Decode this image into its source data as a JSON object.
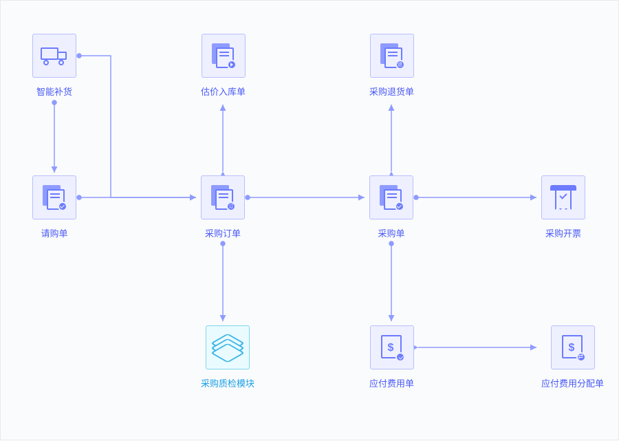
{
  "nodes": {
    "smart_replenish": {
      "label": "智能补货",
      "badge": ""
    },
    "purchase_request": {
      "label": "请购单",
      "badge_type": "check"
    },
    "valuation_inbound": {
      "label": "估价入库单",
      "badge_type": "arrow"
    },
    "purchase_order": {
      "label": "采购订单",
      "badge_text": "订"
    },
    "purchase_return": {
      "label": "采购退货单",
      "badge_text": "退"
    },
    "purchase_receipt": {
      "label": "采购单",
      "badge_type": "check"
    },
    "purchase_invoice": {
      "label": "采购开票"
    },
    "purchase_qc": {
      "label": "采购质检模块"
    },
    "payable_expense": {
      "label": "应付费用单",
      "badge_type": "check"
    },
    "payable_alloc": {
      "label": "应付费用分配单",
      "badge_type": "swap"
    }
  },
  "chart_data": {
    "type": "flow-diagram",
    "nodes": [
      {
        "id": "smart_replenish",
        "label": "智能补货",
        "row": 0,
        "col": 0,
        "icon": "truck"
      },
      {
        "id": "valuation_inbound",
        "label": "估价入库单",
        "row": 0,
        "col": 1,
        "icon": "document-arrow"
      },
      {
        "id": "purchase_return",
        "label": "采购退货单",
        "row": 0,
        "col": 2,
        "icon": "document-return"
      },
      {
        "id": "purchase_request",
        "label": "请购单",
        "row": 1,
        "col": 0,
        "icon": "document-check"
      },
      {
        "id": "purchase_order",
        "label": "采购订单",
        "row": 1,
        "col": 1,
        "icon": "document-order"
      },
      {
        "id": "purchase_receipt",
        "label": "采购单",
        "row": 1,
        "col": 2,
        "icon": "document-check"
      },
      {
        "id": "purchase_invoice",
        "label": "采购开票",
        "row": 1,
        "col": 3,
        "icon": "receipt"
      },
      {
        "id": "purchase_qc",
        "label": "采购质检模块",
        "row": 2,
        "col": 1,
        "icon": "layers",
        "variant": "alt"
      },
      {
        "id": "payable_expense",
        "label": "应付费用单",
        "row": 2,
        "col": 2,
        "icon": "money-check"
      },
      {
        "id": "payable_alloc",
        "label": "应付费用分配单",
        "row": 2,
        "col": 3,
        "icon": "money-swap"
      }
    ],
    "edges": [
      {
        "from": "smart_replenish",
        "to": "purchase_request",
        "direction": "down"
      },
      {
        "from": "smart_replenish",
        "to": "purchase_order",
        "direction": "down-right",
        "bent": true
      },
      {
        "from": "purchase_request",
        "to": "purchase_order",
        "direction": "right"
      },
      {
        "from": "purchase_order",
        "to": "valuation_inbound",
        "direction": "up",
        "bidirectional": true
      },
      {
        "from": "purchase_order",
        "to": "purchase_receipt",
        "direction": "right"
      },
      {
        "from": "purchase_order",
        "to": "purchase_qc",
        "direction": "down"
      },
      {
        "from": "purchase_receipt",
        "to": "purchase_return",
        "direction": "up",
        "bidirectional": true
      },
      {
        "from": "purchase_receipt",
        "to": "purchase_invoice",
        "direction": "right"
      },
      {
        "from": "purchase_receipt",
        "to": "payable_expense",
        "direction": "down"
      },
      {
        "from": "payable_expense",
        "to": "payable_alloc",
        "direction": "right",
        "bidirectional": true
      }
    ]
  }
}
